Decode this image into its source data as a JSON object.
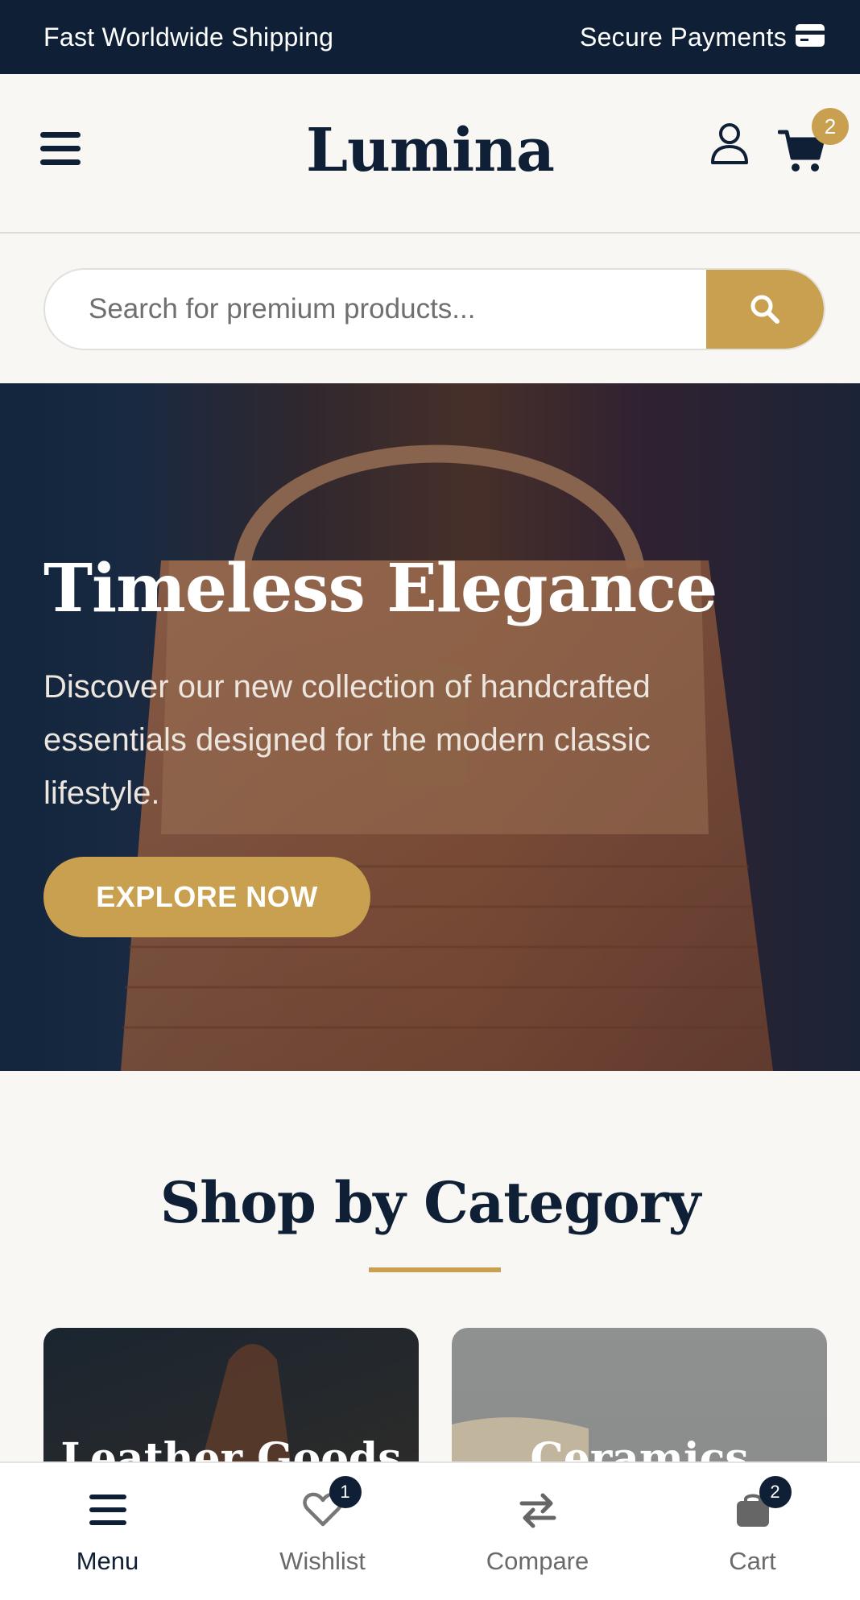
{
  "topbar": {
    "left_text": "Fast Worldwide Shipping",
    "right_text": "Secure Payments",
    "right_icon": "credit-card-icon"
  },
  "header": {
    "logo": "Lumina",
    "cart_count": "2"
  },
  "search": {
    "placeholder": "Search for premium products..."
  },
  "hero": {
    "title": "Timeless Elegance",
    "text": "Discover our new collection of handcrafted essentials designed for the modern classic lifestyle.",
    "button": "EXPLORE NOW"
  },
  "categories": {
    "title": "Shop by Category",
    "items": [
      {
        "label": "Leather Goods"
      },
      {
        "label": "Ceramics"
      }
    ]
  },
  "bottom_nav": {
    "items": [
      {
        "label": "Menu",
        "icon": "hamburger-icon"
      },
      {
        "label": "Wishlist",
        "icon": "heart-icon",
        "badge": "1"
      },
      {
        "label": "Compare",
        "icon": "swap-arrows-icon"
      },
      {
        "label": "Cart",
        "icon": "bag-icon",
        "badge": "2"
      }
    ]
  },
  "colors": {
    "navy": "#0f2036",
    "gold": "#c9a04f",
    "background": "#f8f7f4"
  }
}
